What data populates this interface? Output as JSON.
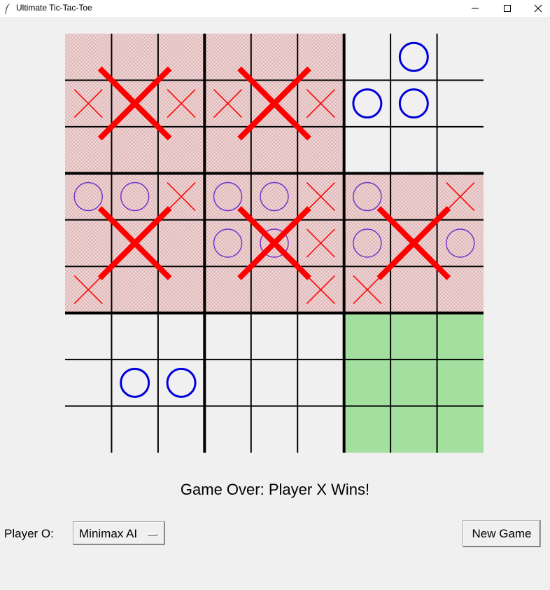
{
  "window": {
    "title": "Ultimate Tic-Tac-Toe",
    "minimize_icon": "minimize-icon",
    "maximize_icon": "maximize-icon",
    "close_icon": "close-icon"
  },
  "board": {
    "boards": [
      {
        "cells": [
          "",
          "",
          "",
          "X",
          "",
          "X",
          "",
          "",
          ""
        ],
        "winner": "X"
      },
      {
        "cells": [
          "",
          "",
          "",
          "X",
          "",
          "X",
          "",
          "",
          ""
        ],
        "winner": "X"
      },
      {
        "cells": [
          "",
          "O",
          "",
          "O",
          "O",
          "",
          "",
          "",
          ""
        ],
        "winner": ""
      },
      {
        "cells": [
          "O",
          "O",
          "X",
          "",
          "",
          "",
          "X",
          "",
          ""
        ],
        "winner": "X"
      },
      {
        "cells": [
          "O",
          "O",
          "X",
          "O",
          "O",
          "X",
          "",
          "",
          "X"
        ],
        "winner": "X"
      },
      {
        "cells": [
          "O",
          "",
          "X",
          "O",
          "",
          "O",
          "X",
          "",
          ""
        ],
        "winner": "X"
      },
      {
        "cells": [
          "",
          "",
          "",
          "",
          "O",
          "O",
          "",
          "",
          ""
        ],
        "winner": ""
      },
      {
        "cells": [
          "",
          "",
          "",
          "",
          "",
          "",
          "",
          "",
          ""
        ],
        "winner": ""
      },
      {
        "cells": [
          "",
          "",
          "",
          "",
          "",
          "",
          "",
          "",
          ""
        ],
        "winner": ""
      }
    ],
    "active_board": 8,
    "colors": {
      "won_fill": "#ecd4d4",
      "active_fill": "#a3e0a0",
      "x": "#ff0000",
      "o_open": "#0000dd",
      "o_won": "#7733cc",
      "grid": "#000000"
    }
  },
  "status_text": "Game Over: Player X Wins!",
  "controls": {
    "player_label": "Player O:",
    "player_o_option": "Minimax AI",
    "new_game_label": "New Game"
  }
}
